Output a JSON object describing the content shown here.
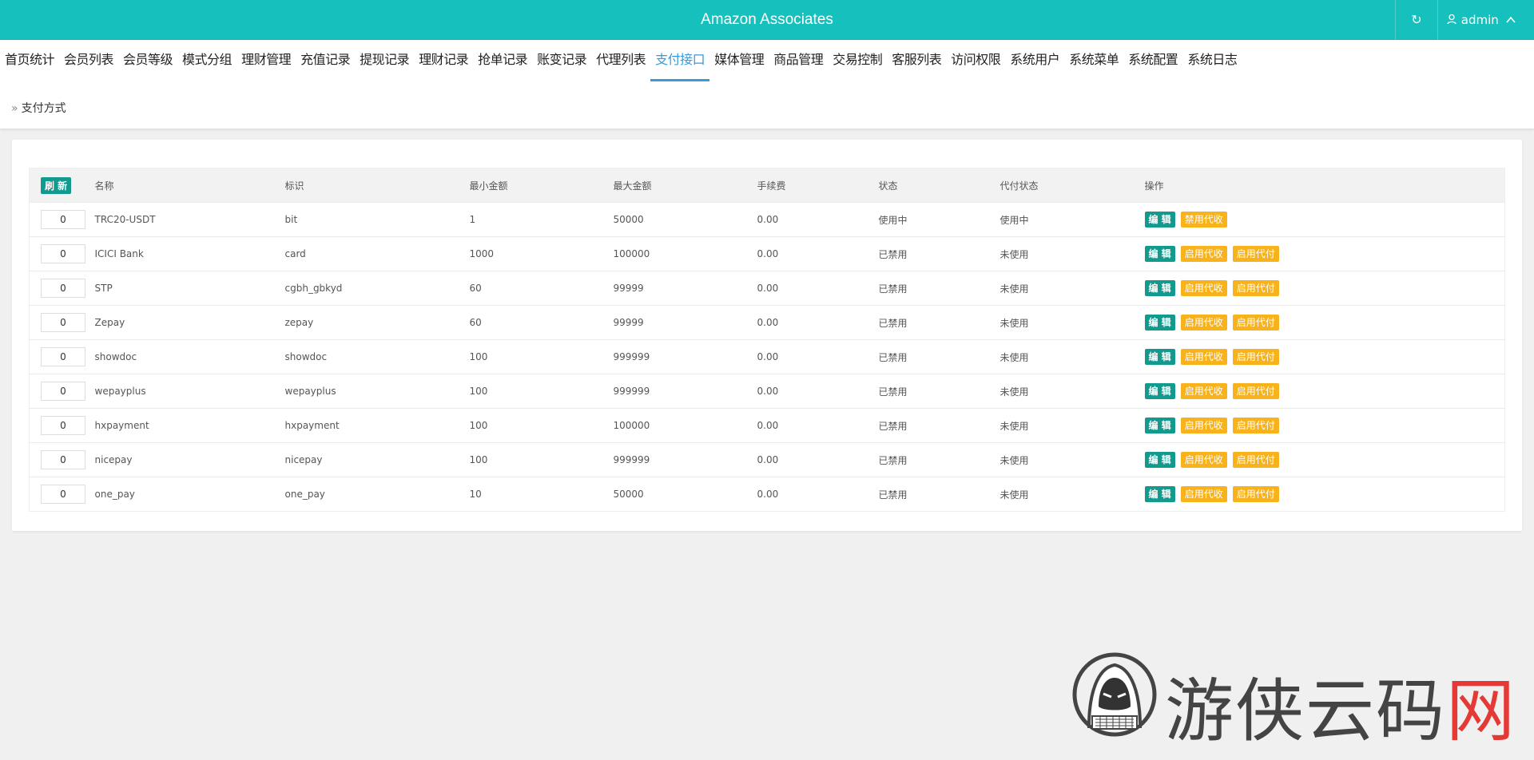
{
  "header": {
    "title": "Amazon Associates",
    "refresh_icon": "refresh-icon",
    "user": "admin"
  },
  "nav": {
    "tabs": [
      {
        "label": "首页统计"
      },
      {
        "label": "会员列表"
      },
      {
        "label": "会员等级"
      },
      {
        "label": "模式分组"
      },
      {
        "label": "理财管理"
      },
      {
        "label": "充值记录"
      },
      {
        "label": "提现记录"
      },
      {
        "label": "理财记录"
      },
      {
        "label": "抢单记录"
      },
      {
        "label": "账变记录"
      },
      {
        "label": "代理列表"
      },
      {
        "label": "支付接口",
        "active": true
      },
      {
        "label": "媒体管理"
      },
      {
        "label": "商品管理"
      },
      {
        "label": "交易控制"
      },
      {
        "label": "客服列表"
      },
      {
        "label": "访问权限"
      },
      {
        "label": "系统用户"
      },
      {
        "label": "系统菜单"
      },
      {
        "label": "系统配置"
      },
      {
        "label": "系统日志"
      }
    ],
    "breadcrumb": "支付方式"
  },
  "table": {
    "refresh_label": "刷 新",
    "columns": {
      "name": "名称",
      "code": "标识",
      "min": "最小金额",
      "max": "最大金额",
      "fee": "手续费",
      "status": "状态",
      "agent_status": "代付状态",
      "actions": "操作"
    },
    "rows": [
      {
        "sort": "0",
        "name": "TRC20-USDT",
        "code": "bit",
        "min": "1",
        "max": "50000",
        "fee": "0.00",
        "status": "使用中",
        "agent_status": "使用中",
        "btn_edit": "编 辑",
        "btn_collect": "禁用代收",
        "btn_pay": ""
      },
      {
        "sort": "0",
        "name": "ICICI Bank",
        "code": "card",
        "min": "1000",
        "max": "100000",
        "fee": "0.00",
        "status": "已禁用",
        "agent_status": "未使用",
        "btn_edit": "编 辑",
        "btn_collect": "启用代收",
        "btn_pay": "启用代付"
      },
      {
        "sort": "0",
        "name": "STP",
        "code": "cgbh_gbkyd",
        "min": "60",
        "max": "99999",
        "fee": "0.00",
        "status": "已禁用",
        "agent_status": "未使用",
        "btn_edit": "编 辑",
        "btn_collect": "启用代收",
        "btn_pay": "启用代付"
      },
      {
        "sort": "0",
        "name": "Zepay",
        "code": "zepay",
        "min": "60",
        "max": "99999",
        "fee": "0.00",
        "status": "已禁用",
        "agent_status": "未使用",
        "btn_edit": "编 辑",
        "btn_collect": "启用代收",
        "btn_pay": "启用代付"
      },
      {
        "sort": "0",
        "name": "showdoc",
        "code": "showdoc",
        "min": "100",
        "max": "999999",
        "fee": "0.00",
        "status": "已禁用",
        "agent_status": "未使用",
        "btn_edit": "编 辑",
        "btn_collect": "启用代收",
        "btn_pay": "启用代付"
      },
      {
        "sort": "0",
        "name": "wepayplus",
        "code": "wepayplus",
        "min": "100",
        "max": "999999",
        "fee": "0.00",
        "status": "已禁用",
        "agent_status": "未使用",
        "btn_edit": "编 辑",
        "btn_collect": "启用代收",
        "btn_pay": "启用代付"
      },
      {
        "sort": "0",
        "name": "hxpayment",
        "code": "hxpayment",
        "min": "100",
        "max": "100000",
        "fee": "0.00",
        "status": "已禁用",
        "agent_status": "未使用",
        "btn_edit": "编 辑",
        "btn_collect": "启用代收",
        "btn_pay": "启用代付"
      },
      {
        "sort": "0",
        "name": "nicepay",
        "code": "nicepay",
        "min": "100",
        "max": "999999",
        "fee": "0.00",
        "status": "已禁用",
        "agent_status": "未使用",
        "btn_edit": "编 辑",
        "btn_collect": "启用代收",
        "btn_pay": "启用代付"
      },
      {
        "sort": "0",
        "name": "one_pay",
        "code": "one_pay",
        "min": "10",
        "max": "50000",
        "fee": "0.00",
        "status": "已禁用",
        "agent_status": "未使用",
        "btn_edit": "编 辑",
        "btn_collect": "启用代收",
        "btn_pay": "启用代付"
      }
    ]
  },
  "watermark": {
    "text_main": "游侠云码",
    "text_red": "网",
    "icon": "hooded-hacker-icon"
  },
  "colors": {
    "header_bg": "#16c0bd",
    "active_tab": "#3a9ad9",
    "edit_button": "#129a8e",
    "warn_button": "#f7b21c",
    "status_active": "#1e8f1e",
    "status_disabled": "#d9534f"
  }
}
